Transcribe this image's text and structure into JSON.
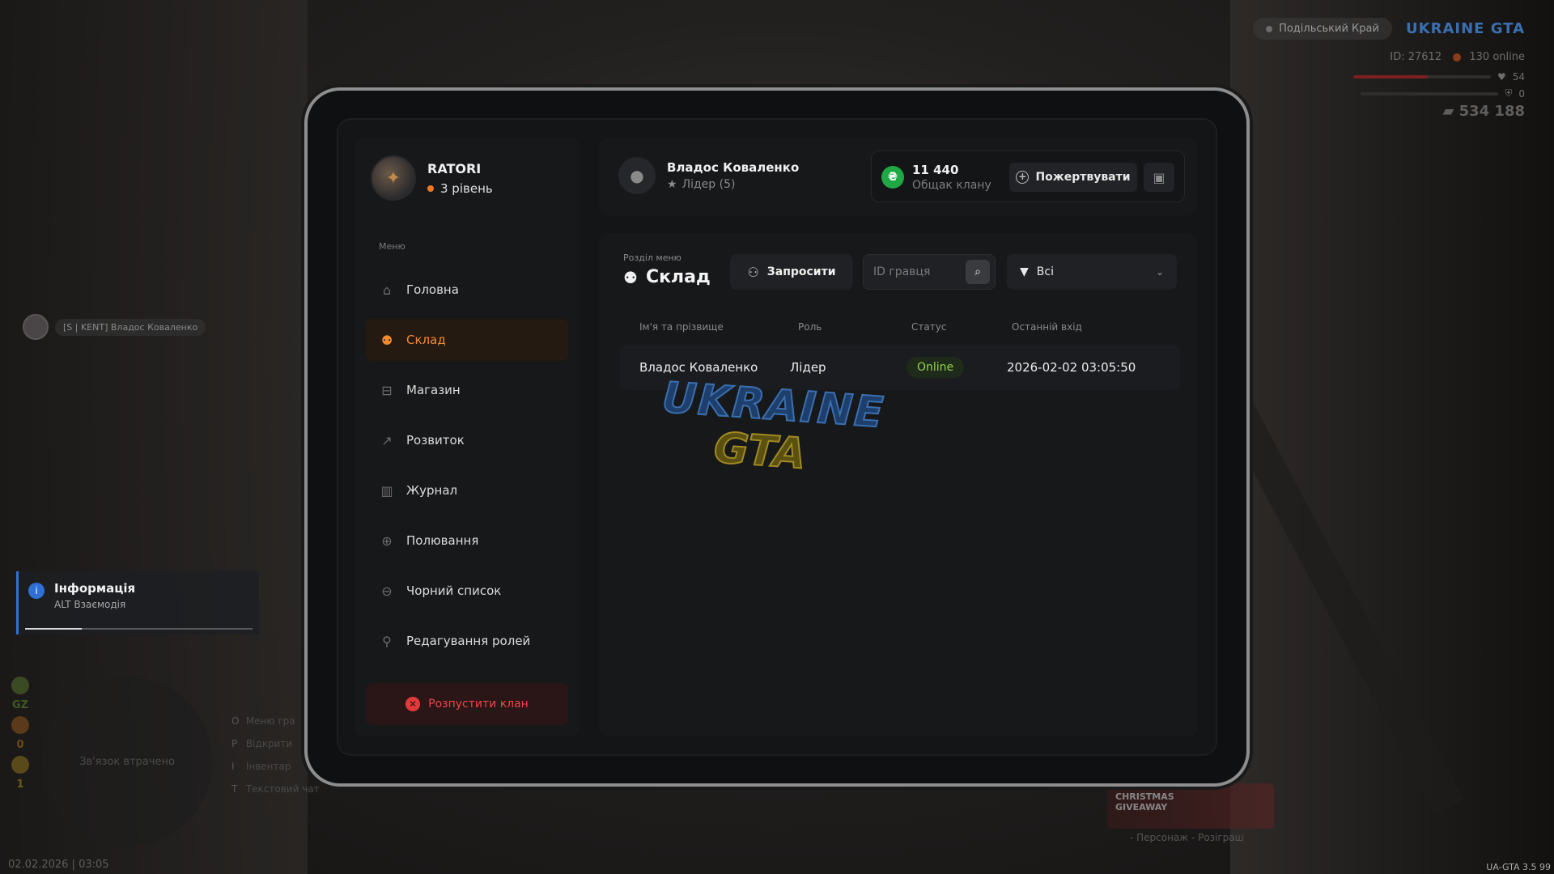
{
  "hud": {
    "server_name": "Подільський Край",
    "game_logo": "UKRAINE GTA",
    "player_id": "ID: 27612",
    "online": "130 online",
    "health": "54",
    "health_level": 54,
    "armor": "0",
    "armor_level": 0,
    "money": "534 188",
    "player_tag": "[S | KENT] Владос Коваленко",
    "stats": [
      "GZ",
      "0",
      "1"
    ],
    "minimap_text": "Зв'язок втрачено",
    "hotkeys": [
      {
        "key": "O",
        "label": "Меню гра"
      },
      {
        "key": "P",
        "label": "Відкрити"
      },
      {
        "key": "I",
        "label": "Інвентар"
      },
      {
        "key": "T",
        "label": "Текстовий чат"
      }
    ],
    "clock": "02.02.2026 | 03:05",
    "version": "UA-GTA 3.5",
    "version_extra": "99",
    "promo_title": "CHRISTMAS GIVEAWAY",
    "promo_sub": "- Персонаж - Розіграш"
  },
  "notification": {
    "title": "Інформація",
    "subtitle": "ALT Взаємодія",
    "progress": 0.25,
    "accent": "#2f6fd6"
  },
  "sidebar": {
    "profile": {
      "name": "RATORI",
      "level": "3 рівень"
    },
    "menu_caption": "Меню",
    "items": [
      {
        "label": "Головна",
        "icon": "home-icon"
      },
      {
        "label": "Склад",
        "icon": "people-icon",
        "active": true
      },
      {
        "label": "Магазин",
        "icon": "basket-icon"
      },
      {
        "label": "Розвиток",
        "icon": "chart-icon"
      },
      {
        "label": "Журнал",
        "icon": "book-icon"
      },
      {
        "label": "Полювання",
        "icon": "crosshair-icon"
      },
      {
        "label": "Чорний список",
        "icon": "block-icon"
      },
      {
        "label": "Редагування ролей",
        "icon": "user-edit-icon"
      }
    ],
    "disband_label": "Розпустити клан"
  },
  "header": {
    "user_name": "Владос Коваленко",
    "user_role": "Лідер (5)",
    "bank_amount": "11 440",
    "bank_label": "Общак клану",
    "donate_label": "Пожертвувати"
  },
  "content": {
    "section_caption": "Розділ меню",
    "section_title": "Склад",
    "invite_label": "Запросити",
    "search_placeholder": "ID гравця",
    "filter_value": "Всі",
    "columns": [
      "Ім'я та прізвище",
      "Роль",
      "Статус",
      "Останній вхід"
    ],
    "rows": [
      {
        "name": "Владос Коваленко",
        "role": "Лідер",
        "status": "Online",
        "last_login": "2026-02-02 03:05:50"
      }
    ],
    "watermark_line1": "UKRAINE",
    "watermark_line2": "GTA"
  },
  "colors": {
    "accent": "#f28a2e",
    "online": "#92d34a",
    "danger": "#ec4848",
    "bank": "#20a844"
  }
}
